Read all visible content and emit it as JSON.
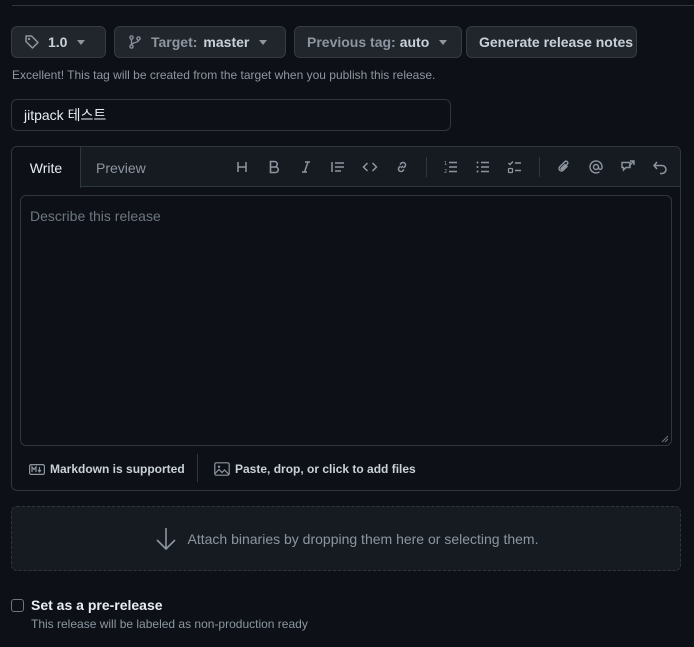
{
  "toolbar": {
    "tag_value": "1.0",
    "target_label": "Target:",
    "target_value": "master",
    "previous_tag_label": "Previous tag:",
    "previous_tag_value": "auto",
    "generate_notes_label": "Generate release notes"
  },
  "hint_text": "Excellent! This tag will be created from the target when you publish this release.",
  "release_title": {
    "value": "jitpack 테스트"
  },
  "editor": {
    "tabs": [
      {
        "label": "Write",
        "active": true
      },
      {
        "label": "Preview",
        "active": false
      }
    ],
    "placeholder": "Describe this release",
    "tool_icons": [
      "heading-icon",
      "bold-icon",
      "italic-icon",
      "quote-icon",
      "code-icon",
      "link-icon",
      "ordered-list-icon",
      "unordered-list-icon",
      "task-list-icon",
      "attach-icon",
      "mention-icon",
      "reference-icon",
      "undo-icon"
    ],
    "markdown_note": "Markdown is supported",
    "files_note": "Paste, drop, or click to add files"
  },
  "dropzone_text": "Attach binaries by dropping them here or selecting them.",
  "prerelease": {
    "label": "Set as a pre-release",
    "note": "This release will be labeled as non-production ready",
    "checked": false
  }
}
